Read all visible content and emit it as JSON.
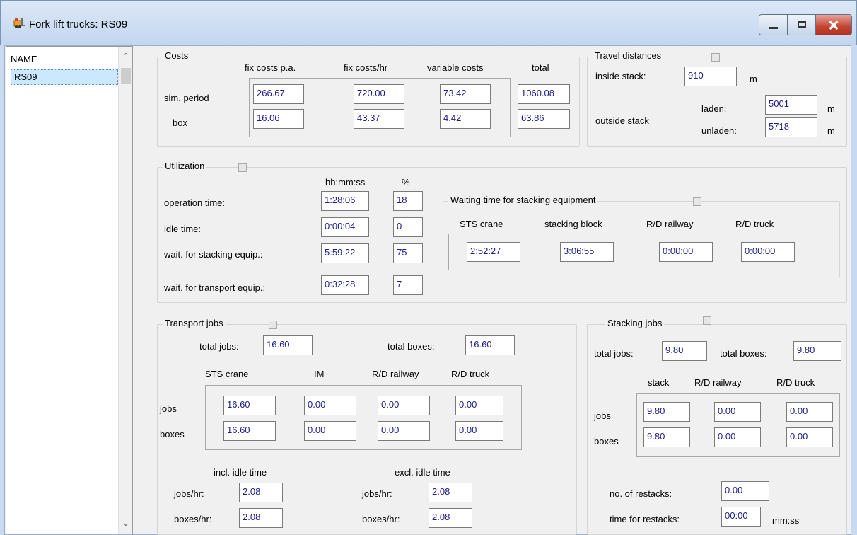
{
  "window": {
    "title": "Fork lift trucks: RS09"
  },
  "list": {
    "header": "NAME",
    "items": [
      "RS09"
    ]
  },
  "costs": {
    "title": "Costs",
    "col_fix_pa": "fix costs p.a.",
    "col_fix_hr": "fix costs/hr",
    "col_variable": "variable costs",
    "col_total": "total",
    "row_sim": "sim. period",
    "row_box": "box",
    "sim": {
      "fix_pa": "266.67",
      "fix_hr": "720.00",
      "variable": "73.42",
      "total": "1060.08"
    },
    "box": {
      "fix_pa": "16.06",
      "fix_hr": "43.37",
      "variable": "4.42",
      "total": "63.86"
    }
  },
  "travel": {
    "title": "Travel distances",
    "inside_label": "inside stack:",
    "inside_value": "910",
    "unit": "m",
    "outside_label": "outside stack",
    "laden_label": "laden:",
    "laden_value": "5001",
    "unladen_label": "unladen:",
    "unladen_value": "5718"
  },
  "utilization": {
    "title": "Utilization",
    "col_time": "hh:mm:ss",
    "col_pct": "%",
    "rows": [
      {
        "label": "operation time:",
        "time": "1:28:06",
        "pct": "18"
      },
      {
        "label": "idle time:",
        "time": "0:00:04",
        "pct": "0"
      },
      {
        "label": "wait. for stacking equip.:",
        "time": "5:59:22",
        "pct": "75"
      },
      {
        "label": "wait. for transport equip.:",
        "time": "0:32:28",
        "pct": "7"
      }
    ]
  },
  "waiting": {
    "title": "Waiting time for stacking equipment",
    "cols": [
      "STS crane",
      "stacking block",
      "R/D railway",
      "R/D truck"
    ],
    "values": [
      "2:52:27",
      "3:06:55",
      "0:00:00",
      "0:00:00"
    ]
  },
  "transport": {
    "title": "Transport jobs",
    "total_jobs_label": "total jobs:",
    "total_jobs": "16.60",
    "total_boxes_label": "total boxes:",
    "total_boxes": "16.60",
    "cols": [
      "STS crane",
      "IM",
      "R/D railway",
      "R/D truck"
    ],
    "row_jobs": "jobs",
    "row_boxes": "boxes",
    "jobs": [
      "16.60",
      "0.00",
      "0.00",
      "0.00"
    ],
    "boxes": [
      "16.60",
      "0.00",
      "0.00",
      "0.00"
    ],
    "incl_label": "incl. idle time",
    "excl_label": "excl. idle time",
    "jobs_hr_label": "jobs/hr:",
    "boxes_hr_label": "boxes/hr:",
    "incl_jobs_hr": "2.08",
    "incl_boxes_hr": "2.08",
    "excl_jobs_hr": "2.08",
    "excl_boxes_hr": "2.08"
  },
  "stacking": {
    "title": "Stacking jobs",
    "total_jobs_label": "total jobs:",
    "total_jobs": "9.80",
    "total_boxes_label": "total boxes:",
    "total_boxes": "9.80",
    "cols": [
      "stack",
      "R/D railway",
      "R/D truck"
    ],
    "row_jobs": "jobs",
    "row_boxes": "boxes",
    "jobs": [
      "9.80",
      "0.00",
      "0.00"
    ],
    "boxes": [
      "9.80",
      "0.00",
      "0.00"
    ],
    "restacks_label": "no. of restacks:",
    "restacks": "0.00",
    "restack_time_label": "time for restacks:",
    "restack_time": "00:00",
    "restack_time_unit": "mm:ss"
  }
}
